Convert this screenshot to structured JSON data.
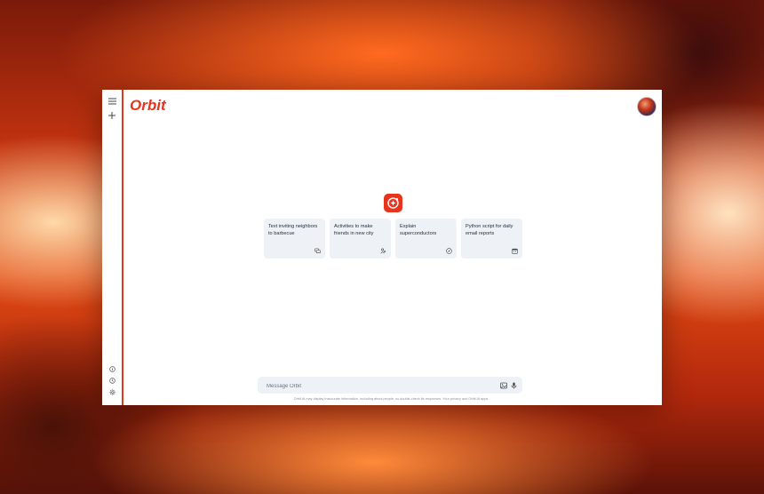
{
  "app": {
    "name": "Orbit",
    "logo_text": "Orbit"
  },
  "sidebar": {
    "menu_icon": "menu-icon",
    "new_chat_icon": "plus-icon",
    "bottom_icons": [
      "help-icon",
      "activity-icon",
      "settings-icon"
    ]
  },
  "suggestions": [
    {
      "text": "Text inviting neighbors to barbecue",
      "icon": "chat-icon"
    },
    {
      "text": "Activities to make friends in new city",
      "icon": "people-icon"
    },
    {
      "text": "Explain superconductors",
      "icon": "compass-icon"
    },
    {
      "text": "Python script for daily email reports",
      "icon": "calendar-icon"
    }
  ],
  "composer": {
    "placeholder": "Message Orbit",
    "image_icon": "image-icon",
    "mic_icon": "mic-icon"
  },
  "footer": {
    "disclaimer": "Orbit AI may display inaccurate information, including about people, so double-check its responses. Your privacy and Orbit AI apps"
  },
  "colors": {
    "accent": "#e8341d",
    "card_bg": "#eef1f6",
    "rail_line": "#e03a1e"
  }
}
